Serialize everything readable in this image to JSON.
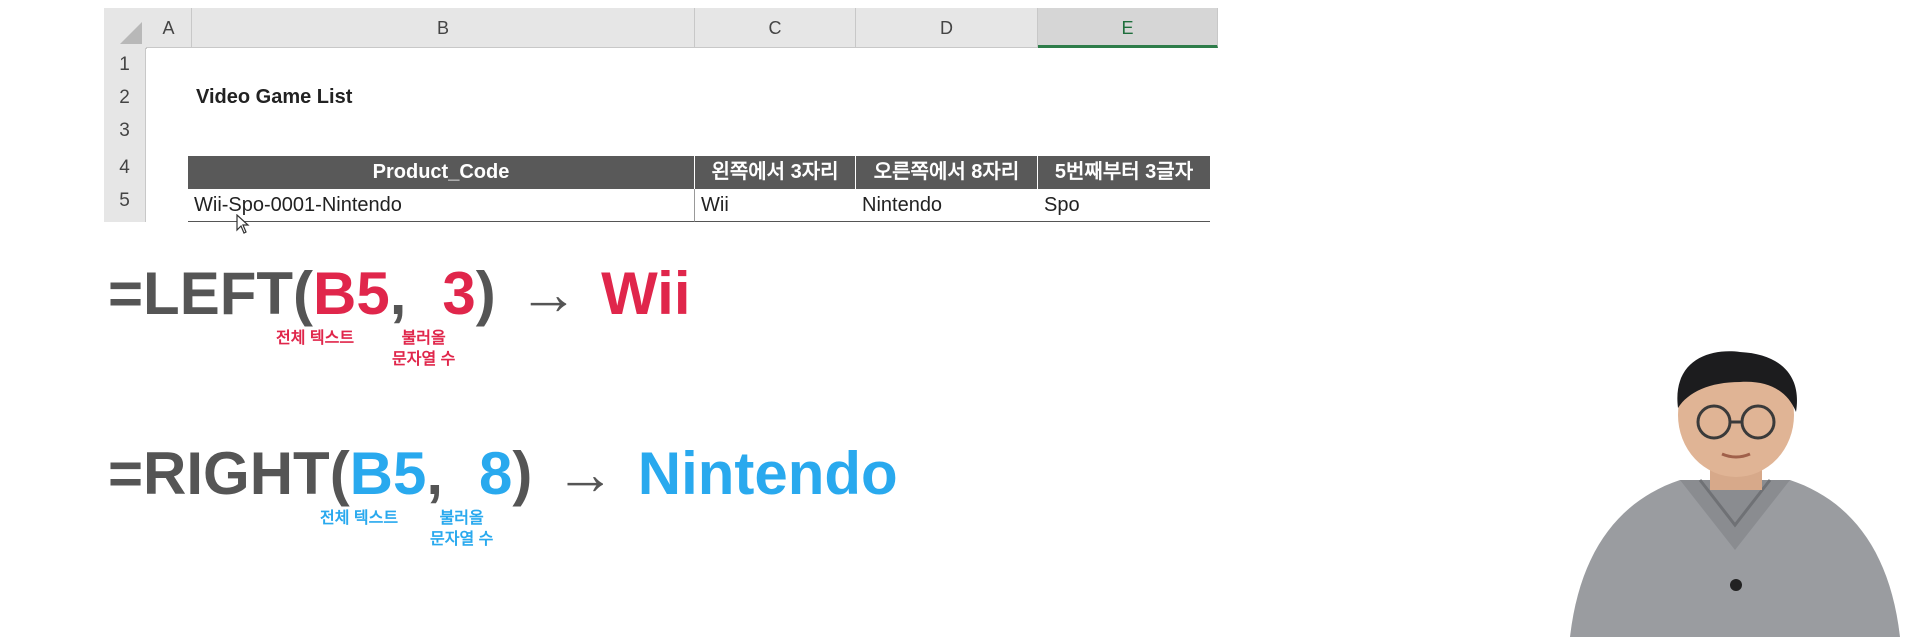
{
  "sheet": {
    "columns": [
      "A",
      "B",
      "C",
      "D",
      "E"
    ],
    "rows": [
      "1",
      "2",
      "3",
      "4",
      "5"
    ],
    "title": "Video Game List",
    "headers": [
      "Product_Code",
      "왼쪽에서 3자리",
      "오른쪽에서 8자리",
      "5번째부터 3글자"
    ],
    "row5": [
      "Wii-Spo-0001-Nintendo",
      "Wii",
      "Nintendo",
      "Spo"
    ]
  },
  "left_formula": {
    "prefix": "=LEFT(",
    "arg1": "B5",
    "comma": ",",
    "arg2": "3",
    "close": ")",
    "arrow": "→",
    "result": "Wii",
    "note1": "전체 텍스트",
    "note2_line1": "불러올",
    "note2_line2": "문자열 수"
  },
  "right_formula": {
    "prefix": "=RIGHT(",
    "arg1": "B5",
    "comma": ",",
    "arg2": "8",
    "close": ")",
    "arrow": "→",
    "result": "Nintendo",
    "note1": "전체 텍스트",
    "note2_line1": "불러올",
    "note2_line2": "문자열 수"
  },
  "colors": {
    "left_accent": "#e0264b",
    "right_accent": "#29a9ee",
    "formula_text": "#555555",
    "header_fill": "#595959",
    "selected_column": "#2e7d4a"
  },
  "icons": [
    "mouse-cursor-icon",
    "select-all-corner-icon"
  ]
}
